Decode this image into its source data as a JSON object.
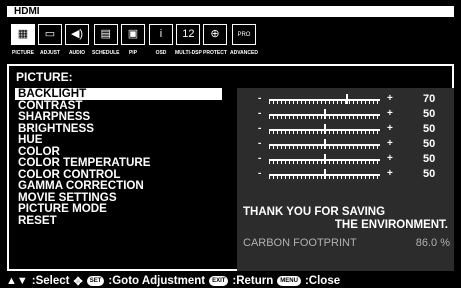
{
  "input_name": "HDMI",
  "tabs": [
    {
      "label": "PICTURE",
      "icon": "picture-icon",
      "glyph": "▦"
    },
    {
      "label": "ADJUST",
      "icon": "adjust-icon",
      "glyph": "▭"
    },
    {
      "label": "AUDIO",
      "icon": "speaker-icon",
      "glyph": "◀)"
    },
    {
      "label": "SCHEDULE",
      "icon": "schedule-icon",
      "glyph": "▤"
    },
    {
      "label": "PIP",
      "icon": "pip-icon",
      "glyph": "▣"
    },
    {
      "label": "OSD",
      "icon": "info-icon",
      "glyph": "i"
    },
    {
      "label": "MULTI-DSP",
      "icon": "multi-display-icon",
      "glyph": "12"
    },
    {
      "label": "PROTECT",
      "icon": "protect-icon",
      "glyph": "⊕"
    },
    {
      "label": "ADVANCED",
      "icon": "advanced-icon",
      "glyph": "PRO"
    }
  ],
  "section_title": "PICTURE:",
  "menu_items": [
    "BACKLIGHT",
    "CONTRAST",
    "SHARPNESS",
    "BRIGHTNESS",
    "HUE",
    "COLOR",
    "COLOR TEMPERATURE",
    "COLOR CONTROL",
    "GAMMA CORRECTION",
    "MOVIE SETTINGS",
    "PICTURE MODE",
    "RESET"
  ],
  "selected_item": "BACKLIGHT",
  "sliders": [
    {
      "for": "BACKLIGHT",
      "value": "70",
      "level": 0.7
    },
    {
      "for": "CONTRAST",
      "value": "50",
      "level": 0.5
    },
    {
      "for": "SHARPNESS",
      "value": "50",
      "level": 0.5
    },
    {
      "for": "BRIGHTNESS",
      "value": "50",
      "level": 0.5
    },
    {
      "for": "HUE",
      "value": "50",
      "level": 0.5
    },
    {
      "for": "COLOR",
      "value": "50",
      "level": 0.5
    }
  ],
  "eco_message": {
    "line1": "THANK YOU FOR SAVING",
    "line2": "THE ENVIRONMENT."
  },
  "carbon": {
    "label": "CARBON FOOTPRINT",
    "value": "86.0 %"
  },
  "footer": {
    "select": ":Select",
    "set_key": "SET",
    "goto": ":Goto Adjustment",
    "exit_key": "EXIT",
    "return": ":Return",
    "menu_key": "MENU",
    "close": ":Close"
  },
  "colors": {
    "panel": "#2c2c2c",
    "background": "#000000",
    "foreground": "#ffffff",
    "muted": "#b0b0b0"
  }
}
